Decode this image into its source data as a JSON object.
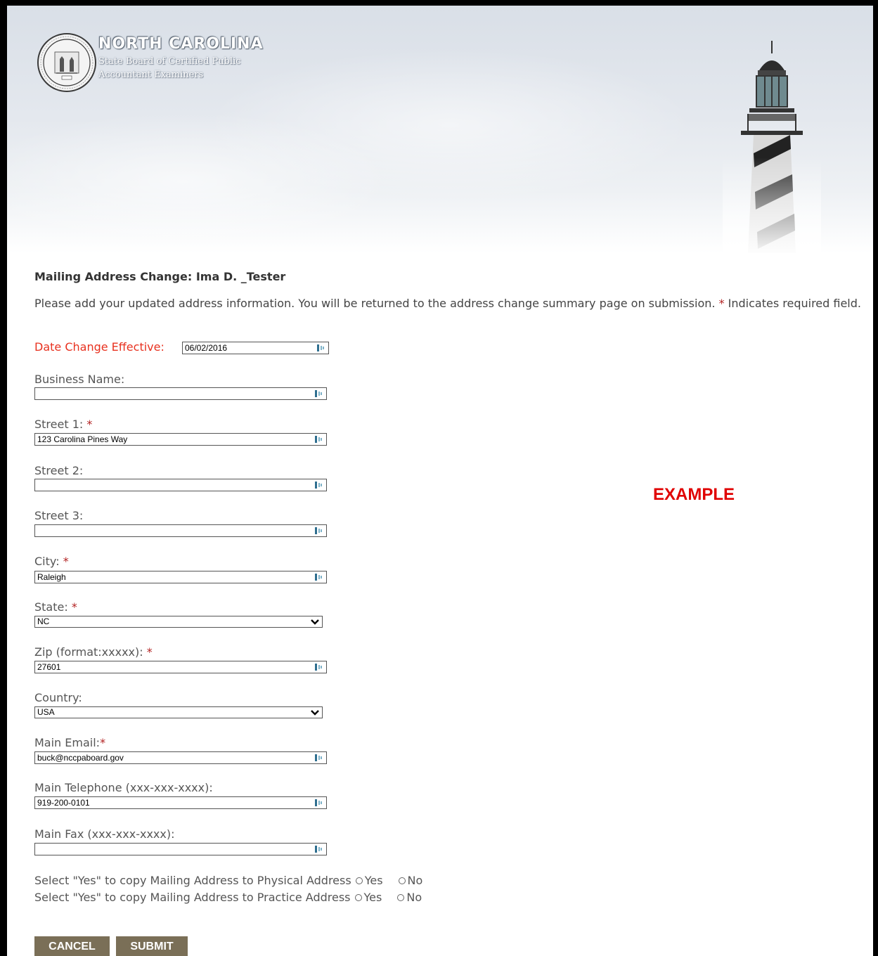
{
  "header": {
    "title": "NORTH CAROLINA",
    "subtitle_line1": "State Board of Certified Public",
    "subtitle_line2": "Accountant Examiners"
  },
  "page": {
    "title": "Mailing Address Change: Ima D. _Tester",
    "instructions": "Please add your updated address information. You will be returned to the address change summary page on submission.",
    "required_marker": "*",
    "required_note": "Indicates required field.",
    "watermark": "EXAMPLE"
  },
  "form": {
    "date_effective_label": "Date Change Effective:",
    "date_effective_value": "06/02/2016",
    "business_name_label": "Business Name:",
    "business_name_value": "",
    "street1_label": "Street 1:",
    "street1_value": "123 Carolina Pines Way",
    "street2_label": "Street 2:",
    "street2_value": "",
    "street3_label": "Street 3:",
    "street3_value": "",
    "city_label": "City:",
    "city_value": "Raleigh",
    "state_label": "State:",
    "state_value": "NC",
    "zip_label": "Zip (format:xxxxx):",
    "zip_value": "27601",
    "country_label": "Country:",
    "country_value": "USA",
    "email_label": "Main Email:",
    "email_value": "buck@nccpaboard.gov",
    "telephone_label": "Main Telephone (xxx-xxx-xxxx):",
    "telephone_value": "919-200-0101",
    "fax_label": "Main Fax (xxx-xxx-xxxx):",
    "fax_value": "",
    "copy_physical_label": "Select \"Yes\" to copy Mailing Address to Physical Address",
    "copy_practice_label": "Select \"Yes\" to copy Mailing Address to Practice Address",
    "yes_label": "Yes",
    "no_label": "No"
  },
  "buttons": {
    "cancel": "CANCEL",
    "submit": "SUBMIT"
  },
  "colors": {
    "required": "#b22222",
    "effective_label": "#e8311f",
    "watermark": "#e00000",
    "button_bg": "#7a6f57"
  }
}
